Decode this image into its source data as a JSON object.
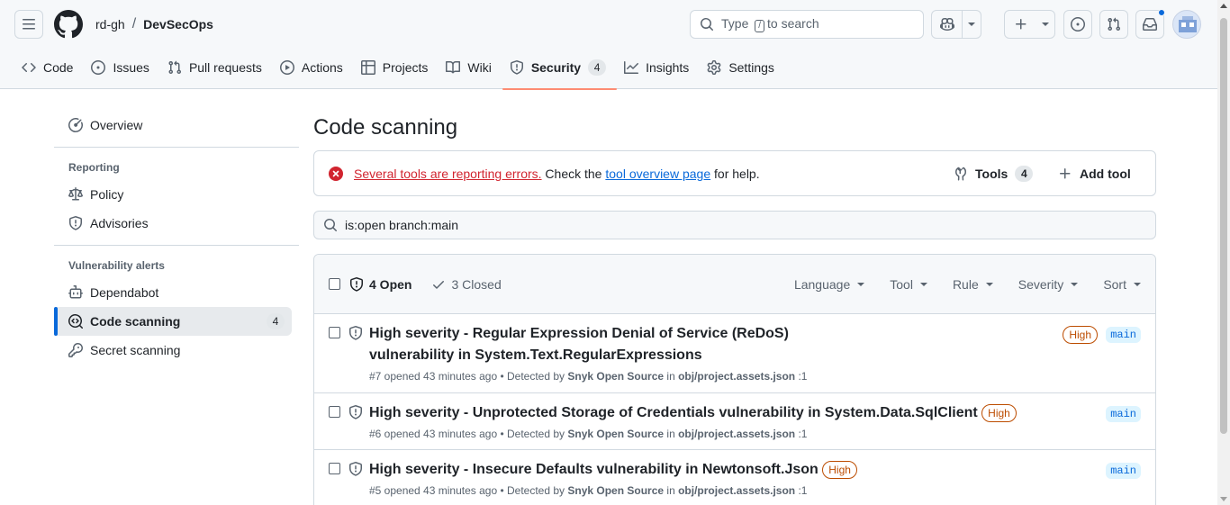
{
  "header": {
    "owner": "rd-gh",
    "separator": "/",
    "repo": "DevSecOps",
    "search_prefix": "Type",
    "search_key": "/",
    "search_suffix": "to search"
  },
  "tabs": [
    {
      "label": "Code",
      "icon": "code-icon"
    },
    {
      "label": "Issues",
      "icon": "issue-opened-icon"
    },
    {
      "label": "Pull requests",
      "icon": "git-pull-request-icon"
    },
    {
      "label": "Actions",
      "icon": "play-icon"
    },
    {
      "label": "Projects",
      "icon": "table-icon"
    },
    {
      "label": "Wiki",
      "icon": "book-icon"
    },
    {
      "label": "Security",
      "icon": "shield-icon",
      "count": "4",
      "selected": true
    },
    {
      "label": "Insights",
      "icon": "graph-icon"
    },
    {
      "label": "Settings",
      "icon": "gear-icon"
    }
  ],
  "sidebar": {
    "overview": "Overview",
    "reporting_heading": "Reporting",
    "policy": "Policy",
    "advisories": "Advisories",
    "vuln_heading": "Vulnerability alerts",
    "dependabot": "Dependabot",
    "code_scanning": "Code scanning",
    "code_scanning_count": "4",
    "secret_scanning": "Secret scanning"
  },
  "main": {
    "title": "Code scanning",
    "flash": {
      "error_link": "Several tools are reporting errors.",
      "text_before_link": " Check the ",
      "tool_link": "tool overview page",
      "text_after_link": " for help."
    },
    "tools_label": "Tools",
    "tools_count": "4",
    "add_tool_label": "Add tool",
    "filter_value": "is:open branch:main",
    "open_label": "4 Open",
    "closed_label": "3 Closed",
    "filters": [
      "Language",
      "Tool",
      "Rule",
      "Severity",
      "Sort"
    ]
  },
  "alerts": [
    {
      "title_line1": "High severity - Regular Expression Denial of Service (ReDoS) vulnerability in",
      "title_line2": "System.Text.RegularExpressions",
      "severity": "High",
      "branch": "main",
      "meta_prefix": "#7 opened 43 minutes ago • Detected by ",
      "tool": "Snyk Open Source",
      "meta_in": " in ",
      "file": "obj/project.assets.json",
      "line": " :1"
    },
    {
      "title_line1": "High severity - Unprotected Storage of Credentials vulnerability in System.Data.SqlClient",
      "severity": "High",
      "branch": "main",
      "meta_prefix": "#6 opened 43 minutes ago • Detected by ",
      "tool": "Snyk Open Source",
      "meta_in": " in ",
      "file": "obj/project.assets.json",
      "line": " :1"
    },
    {
      "title_line1": "High severity - Insecure Defaults vulnerability in Newtonsoft.Json",
      "severity": "High",
      "branch": "main",
      "meta_prefix": "#5 opened 43 minutes ago • Detected by ",
      "tool": "Snyk Open Source",
      "meta_in": " in ",
      "file": "obj/project.assets.json",
      "line": " :1"
    }
  ],
  "colors": {
    "accent": "#0969da",
    "tab_underline": "#fd8c73",
    "severity_high": "#bc4c00",
    "error": "#d1242f"
  }
}
